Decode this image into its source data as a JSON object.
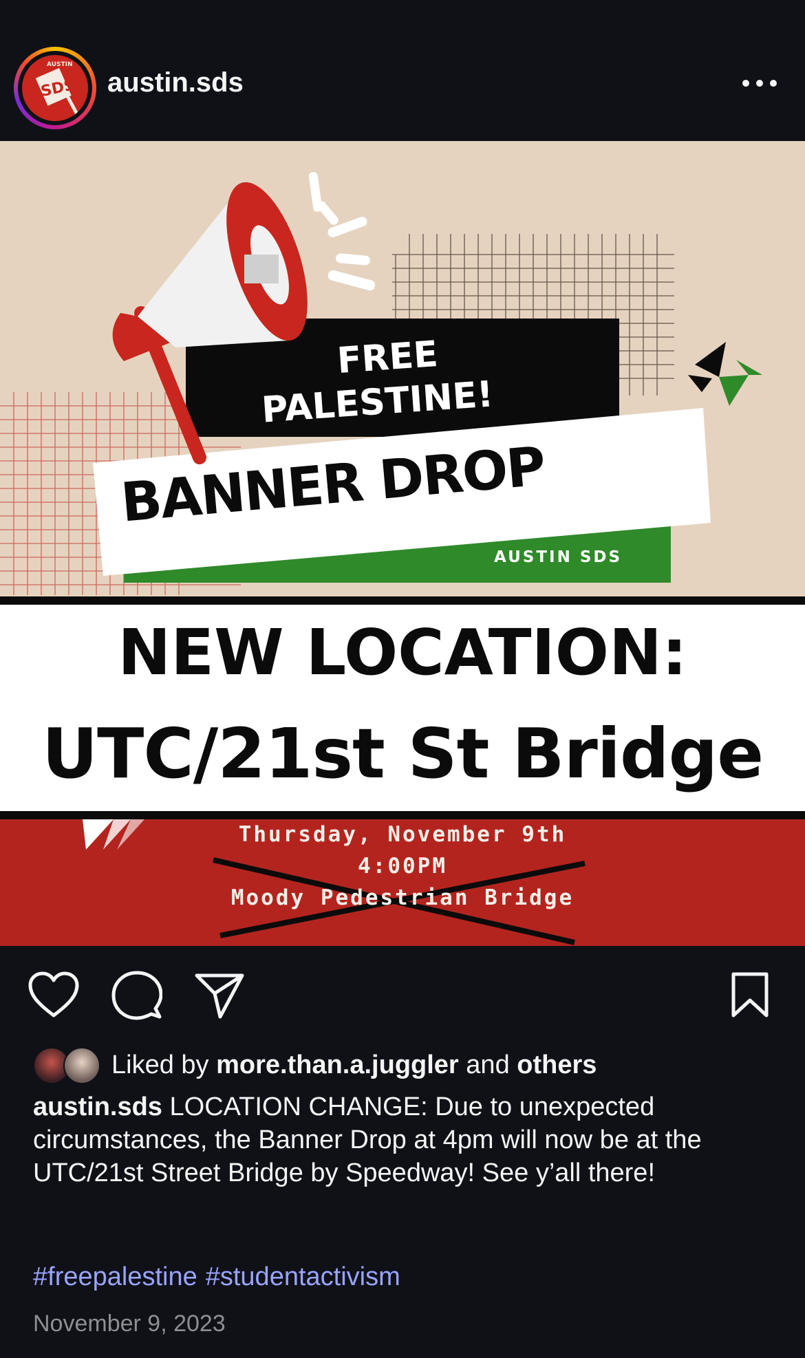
{
  "post_header": {
    "username": "austin.sds",
    "avatar_text": "SDS",
    "avatar_ring_text": "AUSTIN",
    "more_icon": "more-horizontal-icon"
  },
  "post_image": {
    "line1": "FREE",
    "line2": "PALESTINE!",
    "banner": "BANNER DROP",
    "org": "AUSTIN SDS",
    "headline_1": "NEW LOCATION:",
    "headline_2": "UTC/21st St Bridge",
    "event_date": "Thursday, November 9th",
    "event_time": "4:00PM",
    "event_place": "Moody Pedestrian Bridge",
    "colors": {
      "beige": "#e6d3bf",
      "red": "#b3241f",
      "green": "#2f8a2a",
      "black": "#0b0b0b"
    }
  },
  "actions": {
    "like_icon": "heart-icon",
    "comment_icon": "comment-icon",
    "share_icon": "send-icon",
    "save_icon": "bookmark-icon"
  },
  "likes": {
    "prefix": "Liked by",
    "user": "more.than.a.juggler",
    "joiner": "and",
    "others": "others"
  },
  "caption": {
    "username": "austin.sds",
    "text": "LOCATION CHANGE: Due to unexpected circumstances, the Banner Drop at 4pm will now be at the UTC/21st Street Bridge by Speedway! See y’all there!"
  },
  "hashtags": [
    "#freepalestine",
    "#studentactivism"
  ],
  "date": "November 9, 2023"
}
